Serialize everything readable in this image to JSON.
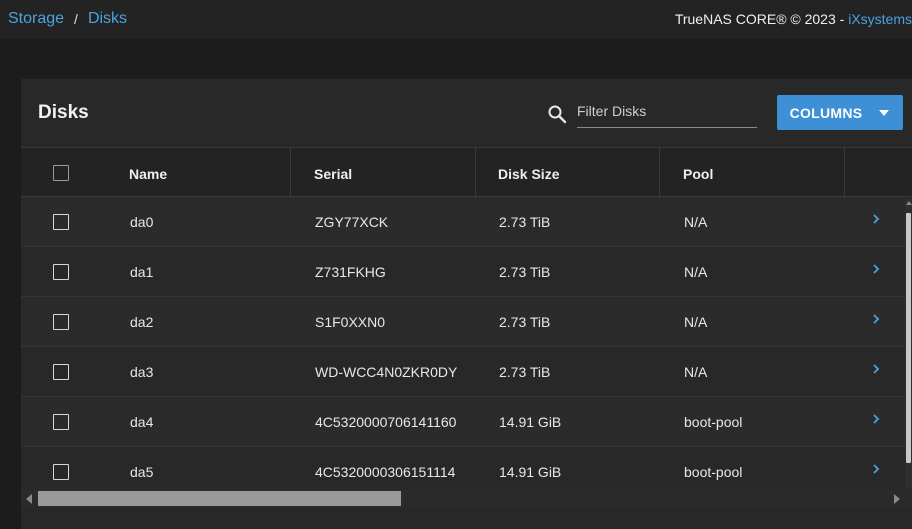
{
  "breadcrumb": {
    "items": [
      "Storage",
      "Disks"
    ],
    "separator": "/"
  },
  "copyright": {
    "text": "TrueNAS CORE® © 2023 - ",
    "vendor": "iXsystems"
  },
  "card": {
    "title": "Disks",
    "filter_placeholder": "Filter Disks",
    "columns_label": "COLUMNS"
  },
  "table": {
    "headers": [
      "Name",
      "Serial",
      "Disk Size",
      "Pool"
    ],
    "rows": [
      {
        "name": "da0",
        "serial": "ZGY77XCK",
        "size": "2.73 TiB",
        "pool": "N/A"
      },
      {
        "name": "da1",
        "serial": "Z731FKHG",
        "size": "2.73 TiB",
        "pool": "N/A"
      },
      {
        "name": "da2",
        "serial": "S1F0XXN0",
        "size": "2.73 TiB",
        "pool": "N/A"
      },
      {
        "name": "da3",
        "serial": "WD-WCC4N0ZKR0DY",
        "size": "2.73 TiB",
        "pool": "N/A"
      },
      {
        "name": "da4",
        "serial": "4C5320000706141160",
        "size": "14.91 GiB",
        "pool": "boot-pool"
      },
      {
        "name": "da5",
        "serial": "4C5320000306151114",
        "size": "14.91 GiB",
        "pool": "boot-pool"
      }
    ]
  },
  "colors": {
    "accent": "#3d8fd6",
    "link": "#4aa3df",
    "background": "#1c1c1c",
    "card": "#282828"
  },
  "icons": {
    "search": "search-icon",
    "dropdown": "caret-down-icon",
    "row_expand": "chevron-right-icon"
  }
}
